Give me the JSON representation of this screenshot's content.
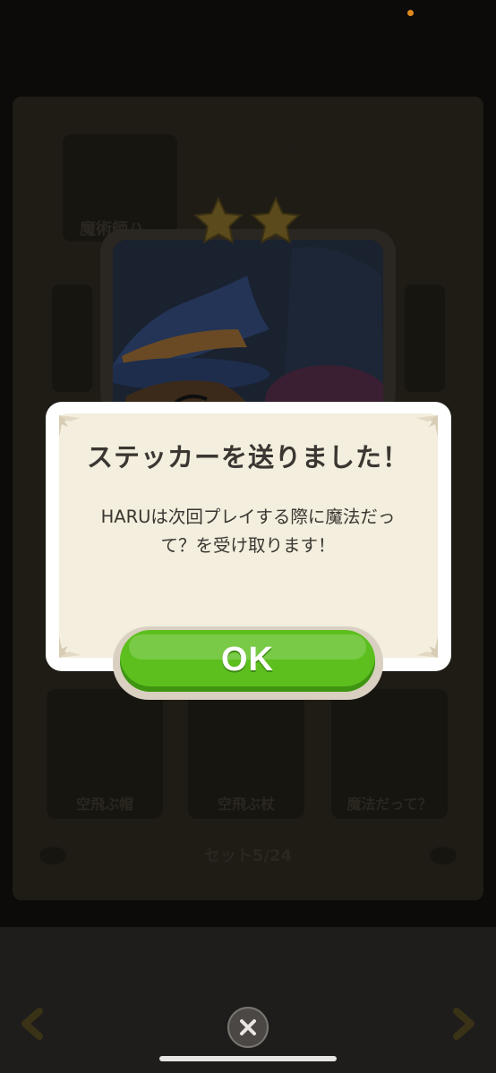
{
  "background": {
    "labels": [
      "魔術師ハ…",
      "空飛ぶ帽",
      "空飛ぶ杖",
      "魔法だって？"
    ],
    "set_count": "セット5/24"
  },
  "dialog": {
    "title": "ステッカーを送りました！",
    "message": "HARUは次回プレイする際に魔法だっ\nて？を受け取ります！",
    "ok_label": "OK"
  },
  "stars": {
    "earned": 2
  },
  "colors": {
    "ok_green": "#5cbf1e",
    "dialog_paper": "#f3eedd",
    "text_dark": "#3b3631",
    "status_dot": "#e08a1e"
  }
}
